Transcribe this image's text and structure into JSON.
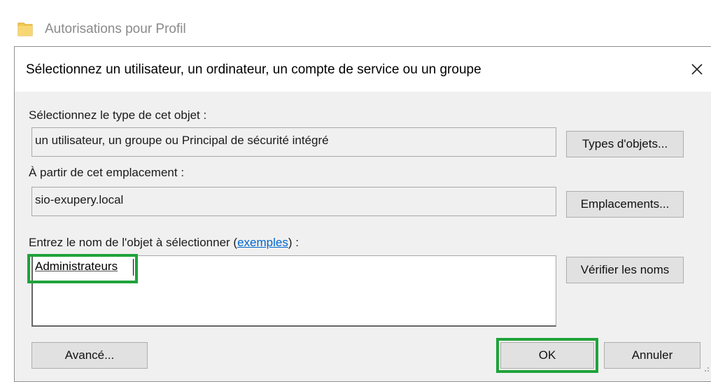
{
  "background_window": {
    "title": "Autorisations pour Profil",
    "icon": "folder-icon"
  },
  "dialog": {
    "title": "Sélectionnez un utilisateur, un ordinateur, un compte de service ou un groupe",
    "object_type": {
      "label": "Sélectionnez le type de cet objet :",
      "value": "un utilisateur, un groupe ou Principal de sécurité intégré",
      "button": "Types d'objets..."
    },
    "location": {
      "label": "À partir de cet emplacement :",
      "value": "sio-exupery.local",
      "button": "Emplacements..."
    },
    "object_name": {
      "label_prefix": "Entrez le nom de l'objet à sélectionner (",
      "link": "exemples",
      "label_suffix": ") :",
      "value": "Administrateurs",
      "check_button": "Vérifier les noms"
    },
    "buttons": {
      "advanced": "Avancé...",
      "ok": "OK",
      "cancel": "Annuler"
    }
  },
  "colors": {
    "highlight": "#1fa33a",
    "link": "#0066cc",
    "dialog_bg": "#f0f0f0",
    "folder": "#f2c94c"
  }
}
